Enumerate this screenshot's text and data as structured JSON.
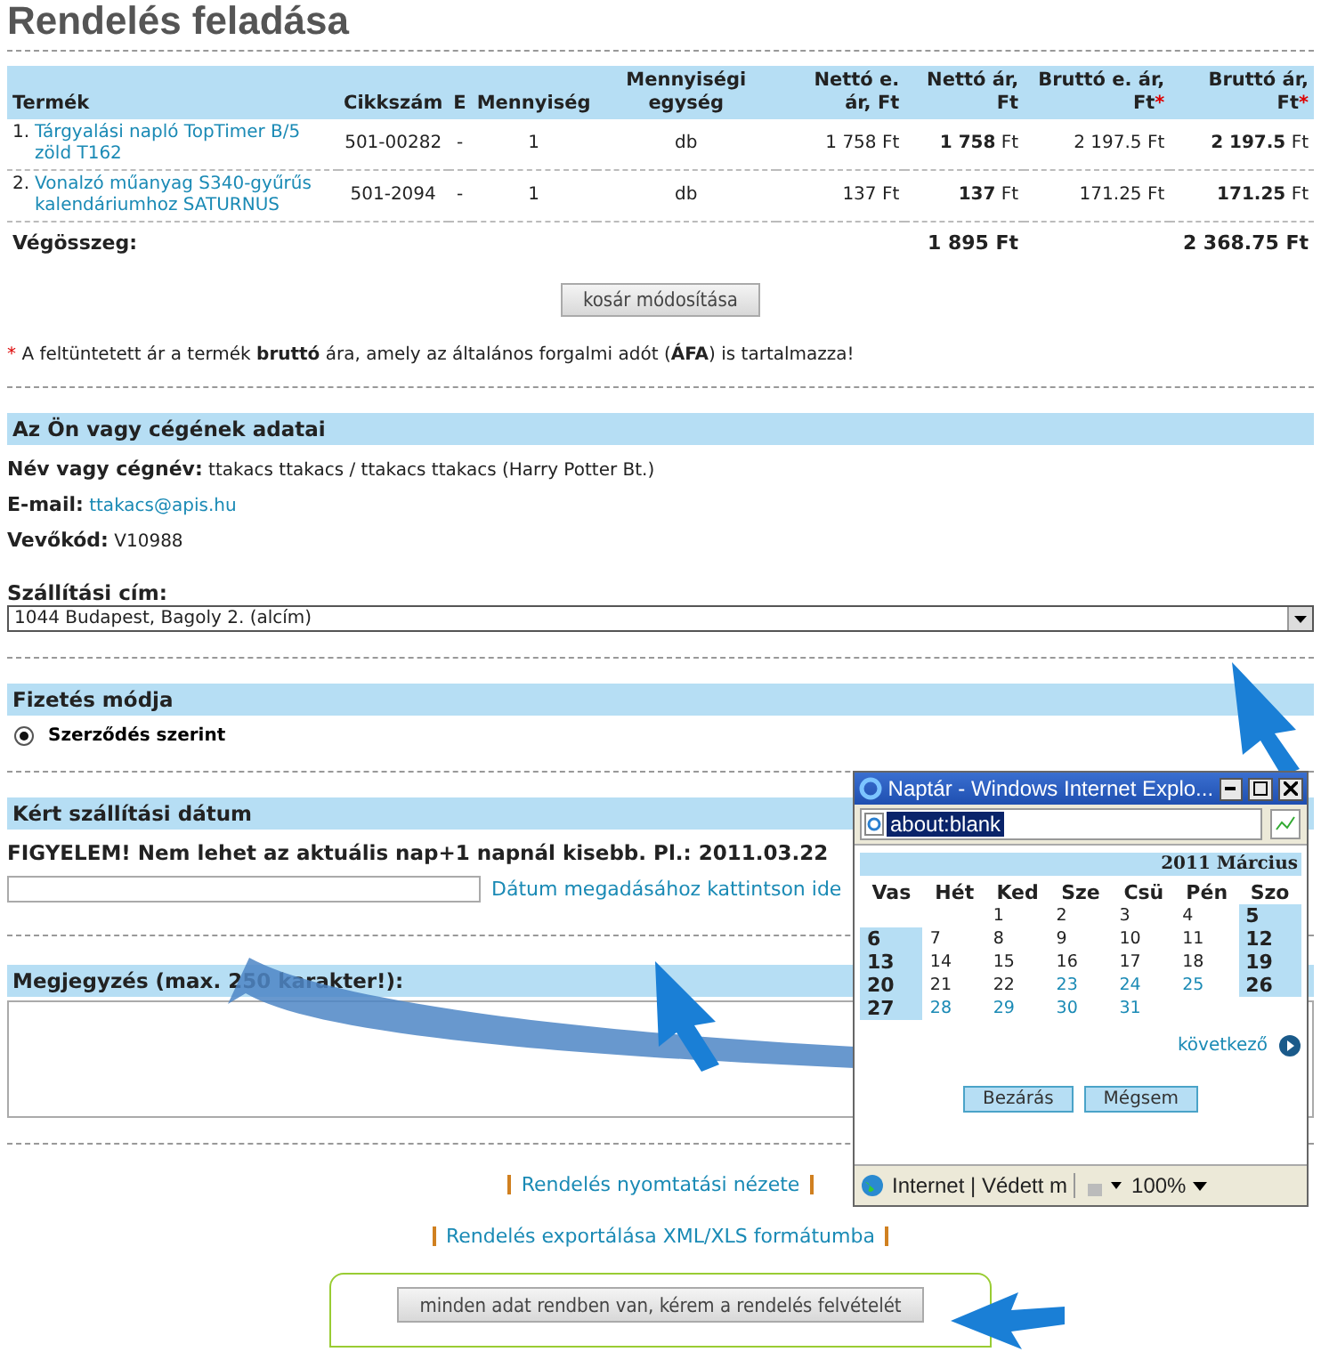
{
  "title": "Rendelés feladása",
  "order_table": {
    "columns": [
      {
        "label": "Termék"
      },
      {
        "label": "Cikkszám"
      },
      {
        "label": "E"
      },
      {
        "label": "Mennyiség"
      },
      {
        "label": "Mennyiségi egység"
      },
      {
        "label": "Nettó e. ár, Ft"
      },
      {
        "label": "Nettó ár, Ft"
      },
      {
        "label": "Bruttó e. ár, Ft",
        "mark": "*"
      },
      {
        "label": "Bruttó ár, Ft",
        "mark": "*"
      }
    ],
    "rows": [
      {
        "number": "1.",
        "product": "Tárgyalási napló TopTimer B/5 zöld T162",
        "code": "501-00282",
        "e": "-",
        "quantity": "1",
        "unit": "db",
        "net_unit": "1 758 Ft",
        "net": "**1 758** Ft",
        "gross_unit": "2 197.5 Ft",
        "gross": "**2 197.5** Ft"
      },
      {
        "number": "2.",
        "product": "Vonalzó műanyag S340-gyűrűs kalendáriumhoz SATURNUS",
        "code": "501-2094",
        "e": "-",
        "quantity": "1",
        "unit": "db",
        "net_unit": "137 Ft",
        "net": "**137** Ft",
        "gross_unit": "171.25 Ft",
        "gross": "**171.25** Ft"
      }
    ],
    "total": {
      "label": "Végösszeg:",
      "net": "1 895 Ft",
      "gross": "2 368.75 Ft"
    }
  },
  "modify_button": "kosár módosítása",
  "footnote": {
    "mark": "*",
    "text": "A feltüntetett ár a termék **bruttó** ára, amely az általános forgalmi adót (**ÁFA**) is tartalmazza!"
  },
  "customer": {
    "heading": "Az Ön vagy cégének adatai",
    "fields": [
      {
        "label": "Név vagy cégnév:",
        "value": "ttakacs ttakacs / ttakacs ttakacs (Harry Potter Bt.)",
        "kind": "text"
      },
      {
        "label": "E-mail:",
        "value": "ttakacs@apis.hu",
        "kind": "link"
      },
      {
        "label": "Vevőkód:",
        "value": "V10988",
        "kind": "text"
      }
    ]
  },
  "shipping_address": {
    "label": "Szállítási cím:",
    "value": "1044 Budapest, Bagoly 2. (alcím)"
  },
  "payment": {
    "heading": "Fizetés módja",
    "options": [
      {
        "label": "Szerződés szerint",
        "selected": true
      }
    ]
  },
  "delivery_date": {
    "heading": "Kért szállítási dátum",
    "warning": "FIGYELEM! Nem lehet az aktuális nap+1 napnál kisebb. Pl.: 2011.03.22",
    "link": "Dátum megadásához kattintson ide"
  },
  "comment": {
    "heading": "Megjegyzés (max. 250 karakter!):"
  },
  "links": [
    "Rendelés nyomtatási nézete",
    "Rendelés exportálása XML/XLS formátumba"
  ],
  "submit_button": "minden adat rendben van, kérem a rendelés felvételét",
  "popup": {
    "title": "Naptár - Windows Internet Explo...",
    "address": "about:blank",
    "month": "2011 Március",
    "day_names": [
      "Vas",
      "Hét",
      "Ked",
      "Sze",
      "Csü",
      "Pén",
      "Szo"
    ],
    "weeks": [
      {
        "kind": "end-aligned",
        "days": [
          {
            "d": "1",
            "weekend": false,
            "selectable": false
          },
          {
            "d": "2",
            "weekend": false,
            "selectable": false
          },
          {
            "d": "3",
            "weekend": false,
            "selectable": false
          },
          {
            "d": "4",
            "weekend": false,
            "selectable": false
          },
          {
            "d": "5",
            "weekend": true,
            "selectable": false
          }
        ]
      },
      {
        "kind": "full",
        "days": [
          {
            "d": "6",
            "weekend": true,
            "selectable": false
          },
          {
            "d": "7",
            "weekend": false,
            "selectable": false
          },
          {
            "d": "8",
            "weekend": false,
            "selectable": false
          },
          {
            "d": "9",
            "weekend": false,
            "selectable": false
          },
          {
            "d": "10",
            "weekend": false,
            "selectable": false
          },
          {
            "d": "11",
            "weekend": false,
            "selectable": false
          },
          {
            "d": "12",
            "weekend": true,
            "selectable": false
          }
        ]
      },
      {
        "kind": "full",
        "days": [
          {
            "d": "13",
            "weekend": true,
            "selectable": false
          },
          {
            "d": "14",
            "weekend": false,
            "selectable": false
          },
          {
            "d": "15",
            "weekend": false,
            "selectable": false
          },
          {
            "d": "16",
            "weekend": false,
            "selectable": false
          },
          {
            "d": "17",
            "weekend": false,
            "selectable": false
          },
          {
            "d": "18",
            "weekend": false,
            "selectable": false
          },
          {
            "d": "19",
            "weekend": true,
            "selectable": false
          }
        ]
      },
      {
        "kind": "full",
        "days": [
          {
            "d": "20",
            "weekend": true,
            "selectable": false
          },
          {
            "d": "21",
            "weekend": false,
            "selectable": false
          },
          {
            "d": "22",
            "weekend": false,
            "selectable": false
          },
          {
            "d": "23",
            "weekend": false,
            "selectable": true
          },
          {
            "d": "24",
            "weekend": false,
            "selectable": true
          },
          {
            "d": "25",
            "weekend": false,
            "selectable": true
          },
          {
            "d": "26",
            "weekend": true,
            "selectable": false
          }
        ]
      },
      {
        "kind": "start-aligned",
        "days": [
          {
            "d": "27",
            "weekend": true,
            "selectable": false
          },
          {
            "d": "28",
            "weekend": false,
            "selectable": true
          },
          {
            "d": "29",
            "weekend": false,
            "selectable": true
          },
          {
            "d": "30",
            "weekend": false,
            "selectable": true
          },
          {
            "d": "31",
            "weekend": false,
            "selectable": true
          }
        ]
      }
    ],
    "next": "következő",
    "buttons": [
      "Bezárás",
      "Mégsem"
    ],
    "status": "Internet | Védett m",
    "zoom": "100%"
  }
}
